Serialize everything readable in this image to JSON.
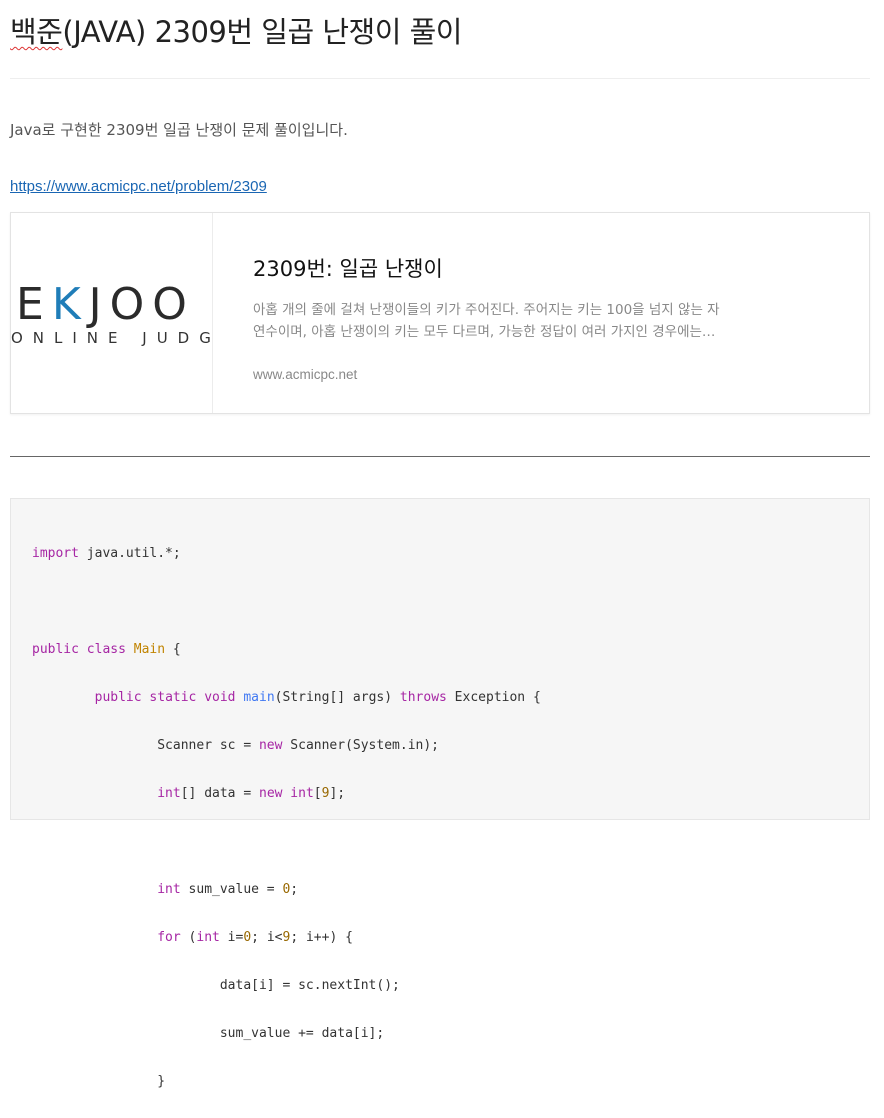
{
  "post": {
    "title_prefix": "백준",
    "title_rest": "(JAVA) 2309번 일곱 난쟁이 풀이",
    "intro": "Java로 구현한 2309번 일곱 난쟁이 문제 풀이입니다.",
    "link": "https://www.acmicpc.net/problem/2309"
  },
  "card": {
    "logo_part1": "E",
    "logo_accent": "K",
    "logo_part2": "JOO",
    "logo_sub": "ONLINE JUDGE",
    "title": "2309번: 일곱 난쟁이",
    "description": "아홉 개의 줄에 걸쳐 난쟁이들의 키가 주어진다. 주어지는 키는 100을 넘지 않는 자연수이며, 아홉 난쟁이의 키는 모두 다르며, 가능한 정답이 여러 가지인 경우에는…",
    "domain": "www.acmicpc.net"
  },
  "code": {
    "l1_kw": "import",
    "l1_rest": " java.util.*;",
    "l3_kw": "public class",
    "l3_cls": "Main",
    "l3_rest": " {",
    "l4_indent": "        ",
    "l4_kw": "public static void",
    "l4_fn": "main",
    "l4_args": "(String[] args) ",
    "l4_kw2": "throws",
    "l4_rest": " Exception {",
    "l5_indent": "                ",
    "l5_a": "Scanner sc = ",
    "l5_kw": "new",
    "l5_b": " Scanner(System.in);",
    "l6_kw": "int",
    "l6_a": "[] data = ",
    "l6_kw2": "new",
    "l6_kw3": " int",
    "l6_b": "[",
    "l6_num": "9",
    "l6_c": "];",
    "l8_kw": "int",
    "l8_a": " sum_value = ",
    "l8_num": "0",
    "l8_b": ";",
    "l9_kw": "for",
    "l9_a": " (",
    "l9_kw2": "int",
    "l9_b": " i=",
    "l9_num": "0",
    "l9_c": "; i<",
    "l9_num2": "9",
    "l9_d": "; i++) {",
    "l10_indent": "                        ",
    "l10_a": "data[i] = sc.nextInt();",
    "l11_a": "sum_value += data[i];",
    "l12_a": "}"
  }
}
